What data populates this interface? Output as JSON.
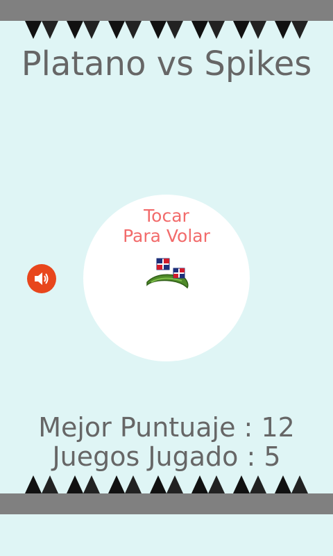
{
  "title": "Platano vs Spikes",
  "prompt": {
    "line1": "Tocar",
    "line2": "Para Volar"
  },
  "stats": {
    "best_score": "Mejor Puntuaje : 12",
    "games_played": "Juegos Jugado : 5"
  },
  "sound": {
    "icon": "speaker-icon",
    "state": "on"
  },
  "colors": {
    "background": "#dff5f5",
    "bars": "#808080",
    "spikes": "#111111",
    "title_text": "#666666",
    "prompt_text": "#f26b6b",
    "sound_button": "#e8461c",
    "circle": "#ffffff"
  }
}
